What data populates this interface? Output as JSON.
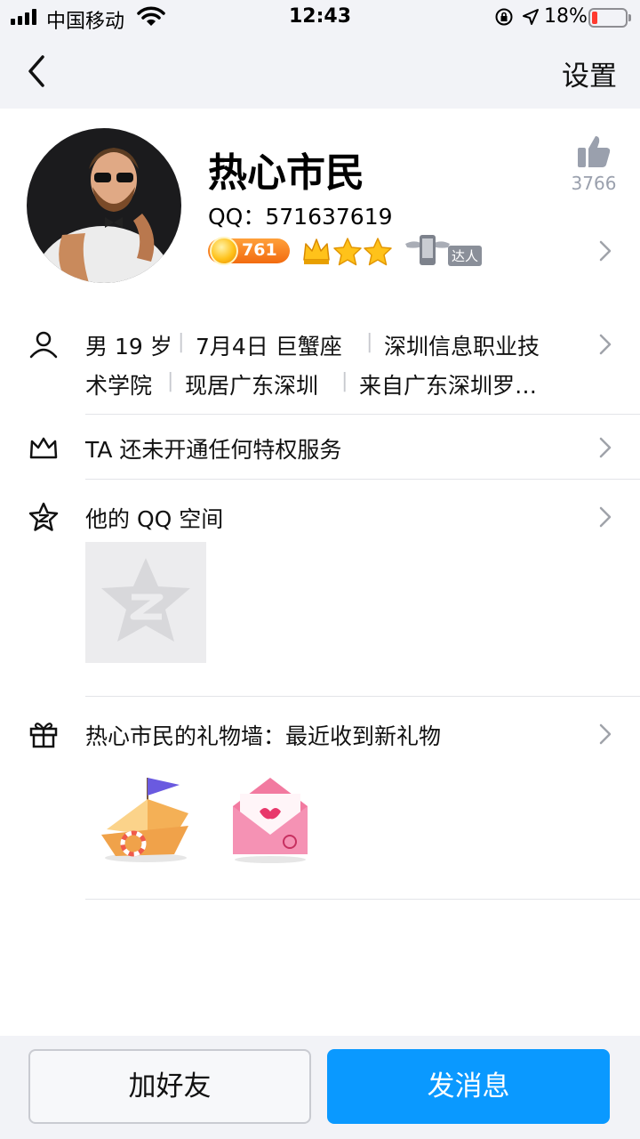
{
  "status_bar": {
    "carrier": "中国移动",
    "time": "12:43",
    "battery": "18%",
    "battery_level": 0.18,
    "battery_color": "#ff3b30"
  },
  "nav": {
    "back_icon": "chevron-left-icon",
    "settings_label": "设置"
  },
  "profile": {
    "name": "热心市民",
    "qq_id": "QQ：571637619",
    "likes_count": "3766",
    "level_number": "761",
    "badge_label": "达人"
  },
  "rows": {
    "info_line1": [
      "男 19 岁",
      "7月4日 巨蟹座",
      "深圳信息职业技"
    ],
    "info_line2": [
      "术学院",
      "现居广东深圳",
      "来自广东深圳罗…"
    ],
    "vip_text": "TA 还未开通任何特权服务",
    "qzone_text": "他的 QQ 空间",
    "gift_text": "热心市民的礼物墙：最近收到新礼物"
  },
  "actions": {
    "add_friend": "加好友",
    "send_message": "发消息"
  },
  "colors": {
    "accent": "#0a99ff",
    "bar_bg": "#f2f3f7",
    "level_badge": "#f26b10"
  }
}
